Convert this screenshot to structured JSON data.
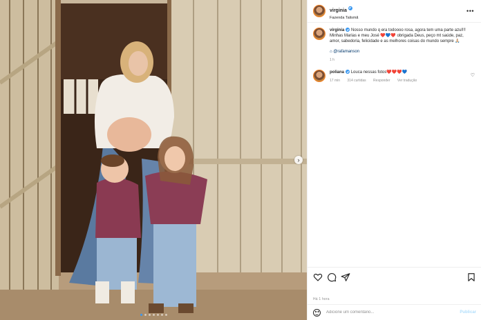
{
  "post": {
    "username": "virginia",
    "location": "Fazenda Talismã",
    "caption_text": "Nosso mundo q era todoooo rosa, agora tem uma parte azul!!! Minhas Marias e meu José ❤️💙❤️ obrigada Deus, peço mt saúde, paz, amor, sabedoria, felicidade e as melhores coisas do mundo sempre 🙏🏼",
    "tagged_user": "@rafamanson",
    "caption_time": "1 h",
    "posted_time": "Há 1 hora"
  },
  "comment": {
    "username": "poliana",
    "text": "Louca nessas fotos❤️❤️❤️💙",
    "time": "17 min",
    "likes": "314 curtidas",
    "reply_label": "Responder",
    "translate_label": "Ver tradução"
  },
  "composer": {
    "placeholder": "Adicione um comentário...",
    "publish_label": "Publicar"
  },
  "icons": {
    "more": "more-options-icon",
    "like": "heart-icon",
    "comment": "comment-icon",
    "share": "share-icon",
    "save": "bookmark-icon",
    "emoji": "emoji-icon",
    "carousel_next": "chevron-right-icon"
  },
  "carousel": {
    "slides": 7,
    "active_slide": 1
  },
  "colors": {
    "verified": "#3897f0",
    "link": "#00376b",
    "muted": "#8e8e8e",
    "publish_disabled": "#b2dffc"
  }
}
